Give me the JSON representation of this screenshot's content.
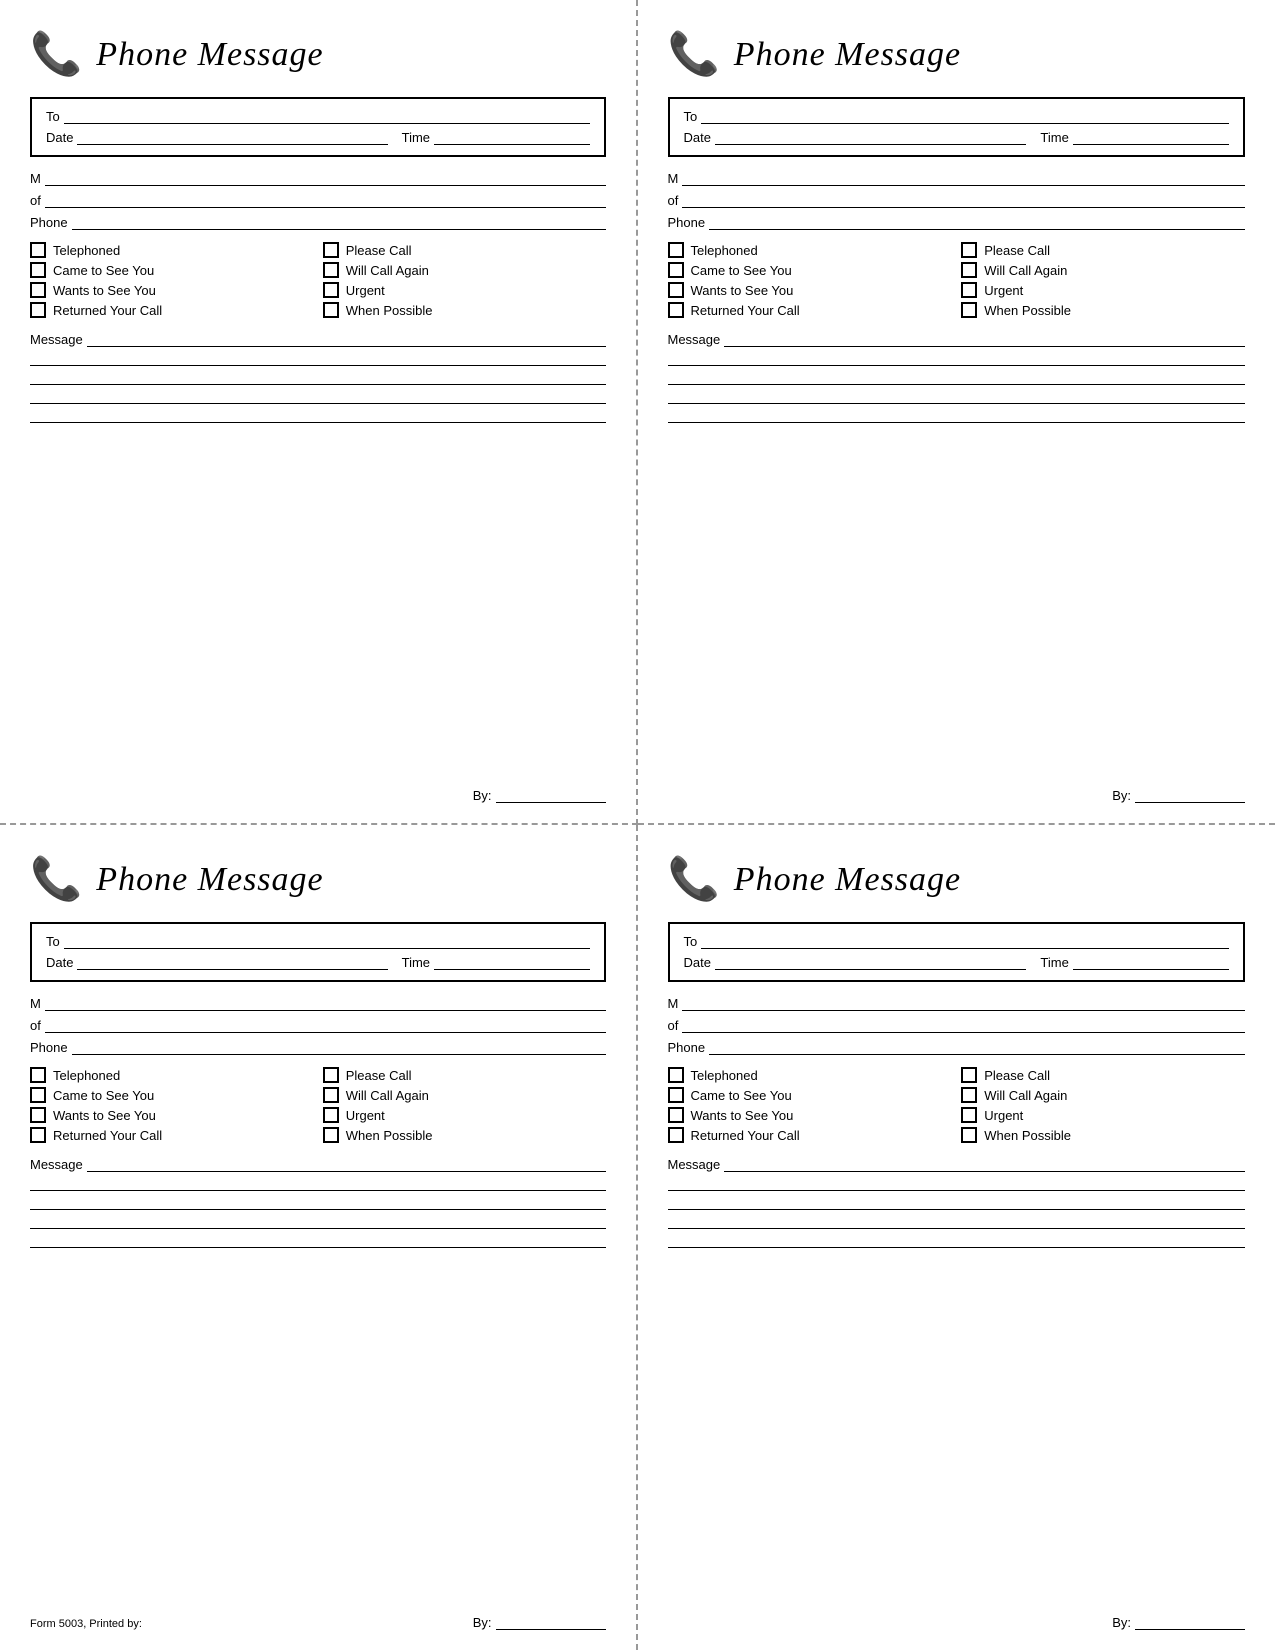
{
  "form": {
    "title": "Phone Message",
    "phone_icon": "☎",
    "labels": {
      "to": "To",
      "date": "Date",
      "time": "Time",
      "m": "M",
      "of": "of",
      "phone": "Phone",
      "message": "Message",
      "by": "By:"
    },
    "checkboxes": {
      "col1": [
        "Telephoned",
        "Came to See You",
        "Wants to See You",
        "Returned Your Call"
      ],
      "col2": [
        "Please Call",
        "Will Call Again",
        "Urgent",
        "When Possible"
      ]
    },
    "footer": {
      "form_number": "Form 5003, Printed by:",
      "by_label": "By:"
    }
  }
}
